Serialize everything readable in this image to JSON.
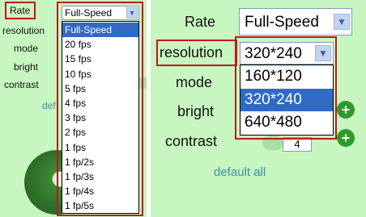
{
  "left": {
    "labels": {
      "rate": "Rate",
      "resolution": "resolution",
      "mode": "mode",
      "bright": "bright",
      "contrast": "contrast"
    },
    "default_link_partial": "def",
    "rate_select": {
      "value": "Full-Speed",
      "arrow": "chevron-down-icon"
    },
    "rate_options": [
      "Full-Speed",
      "20 fps",
      "15 fps",
      "10 fps",
      "5 fps",
      "4 fps",
      "3 fps",
      "2 fps",
      "1 fps",
      "1 fp/2s",
      "1 fp/3s",
      "1 fp/4s",
      "1 fp/5s"
    ],
    "rate_highlighted": "Full-Speed"
  },
  "right": {
    "labels": {
      "rate": "Rate",
      "resolution": "resolution",
      "mode": "mode",
      "bright": "bright",
      "contrast": "contrast"
    },
    "rate_select": {
      "value": "Full-Speed",
      "arrow": "chevron-down-icon"
    },
    "resolution_select": {
      "value": "320*240",
      "arrow": "chevron-down-icon"
    },
    "resolution_options": [
      "160*120",
      "320*240",
      "640*480"
    ],
    "resolution_highlighted": "320*240",
    "contrast_value": "4",
    "plus_symbol": "+",
    "default_all": "default all"
  },
  "colors": {
    "panel_bg": "#c8f6c0",
    "highlight_box": "#c0171c",
    "selection": "#316ac5",
    "link": "#3a8fa6",
    "plus_button": "#2e9a2a"
  }
}
